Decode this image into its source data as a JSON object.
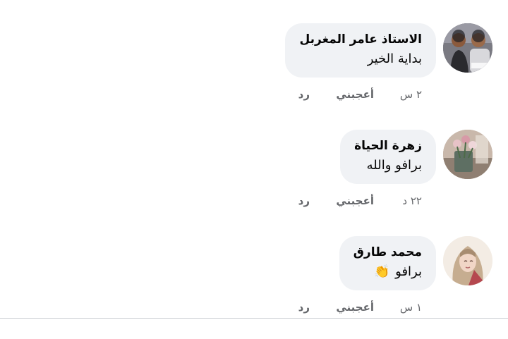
{
  "comments": [
    {
      "author": "الاستاذ عامر المغربل",
      "text": "بداية الخير",
      "emoji": "",
      "time": "٢ س",
      "like_label": "أعجبني",
      "reply_label": "رد",
      "avatar": "avatar-two-men-photo"
    },
    {
      "author": "زهرة الحياة",
      "text": "برافو والله",
      "emoji": "",
      "time": "٢٢ د",
      "like_label": "أعجبني",
      "reply_label": "رد",
      "avatar": "avatar-flowers-photo"
    },
    {
      "author": "محمد طارق",
      "text": "برافو",
      "emoji": "👏",
      "time": "١ س",
      "like_label": "أعجبني",
      "reply_label": "رد",
      "avatar": "avatar-hijab-illustration"
    }
  ],
  "colors": {
    "bubble_bg": "#f0f2f5",
    "name_text": "#050505",
    "meta_text": "#65676b",
    "divider": "#c9ccd1"
  }
}
